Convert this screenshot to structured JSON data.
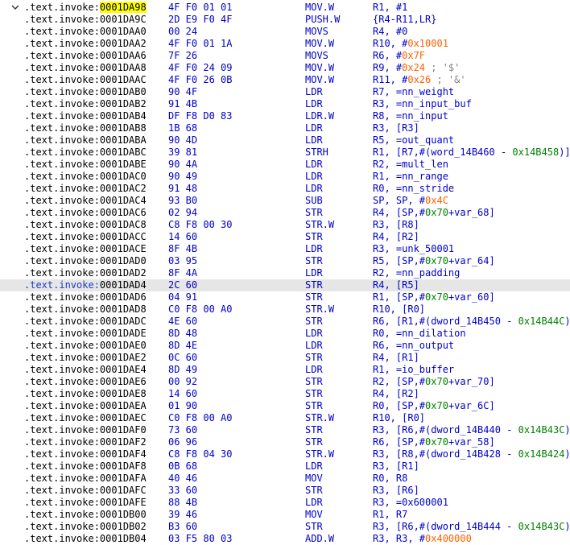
{
  "listing": {
    "rows": [
      {
        "seg": ".text.invoke:",
        "addr": "0001DA98",
        "bytes": "4F F0 01 01",
        "mn": "MOV.W",
        "ops": [
          [
            "R1, ",
            ""
          ],
          [
            "#1",
            ""
          ]
        ],
        "addr_highlight": true,
        "expanded": true
      },
      {
        "seg": ".text.invoke:",
        "addr": "0001DA9C",
        "bytes": "2D E9 F0 4F",
        "mn": "PUSH.W",
        "ops": [
          [
            "{R4-R11,LR}",
            ""
          ]
        ]
      },
      {
        "seg": ".text.invoke:",
        "addr": "0001DAA0",
        "bytes": "00 24",
        "mn": "MOVS",
        "ops": [
          [
            "R4, #0",
            ""
          ]
        ]
      },
      {
        "seg": ".text.invoke:",
        "addr": "0001DAA2",
        "bytes": "4F F0 01 1A",
        "mn": "MOV.W",
        "ops": [
          [
            "R10, #",
            ""
          ],
          [
            "0x10001",
            "num"
          ]
        ]
      },
      {
        "seg": ".text.invoke:",
        "addr": "0001DAA6",
        "bytes": "7F 26",
        "mn": "MOVS",
        "ops": [
          [
            "R6, #",
            ""
          ],
          [
            "0x7F",
            "num"
          ]
        ]
      },
      {
        "seg": ".text.invoke:",
        "addr": "0001DAA8",
        "bytes": "4F F0 24 09",
        "mn": "MOV.W",
        "ops": [
          [
            "R9, #",
            ""
          ],
          [
            "0x24",
            "num"
          ],
          [
            " ; '$'",
            "cmt"
          ]
        ]
      },
      {
        "seg": ".text.invoke:",
        "addr": "0001DAAC",
        "bytes": "4F F0 26 0B",
        "mn": "MOV.W",
        "ops": [
          [
            "R11, #",
            ""
          ],
          [
            "0x26",
            "num"
          ],
          [
            " ; '&'",
            "cmt"
          ]
        ]
      },
      {
        "seg": ".text.invoke:",
        "addr": "0001DAB0",
        "bytes": "90 4F",
        "mn": "LDR",
        "ops": [
          [
            "R7, =nn_weight",
            ""
          ]
        ]
      },
      {
        "seg": ".text.invoke:",
        "addr": "0001DAB2",
        "bytes": "91 4B",
        "mn": "LDR",
        "ops": [
          [
            "R3, =nn_input_buf",
            ""
          ]
        ]
      },
      {
        "seg": ".text.invoke:",
        "addr": "0001DAB4",
        "bytes": "DF F8 D0 83",
        "mn": "LDR.W",
        "ops": [
          [
            "R8, =nn_input",
            ""
          ]
        ]
      },
      {
        "seg": ".text.invoke:",
        "addr": "0001DAB8",
        "bytes": "1B 68",
        "mn": "LDR",
        "ops": [
          [
            "R3, [R3]",
            ""
          ]
        ]
      },
      {
        "seg": ".text.invoke:",
        "addr": "0001DABA",
        "bytes": "90 4D",
        "mn": "LDR",
        "ops": [
          [
            "R5, =out_quant",
            ""
          ]
        ]
      },
      {
        "seg": ".text.invoke:",
        "addr": "0001DABC",
        "bytes": "39 81",
        "mn": "STRH",
        "ops": [
          [
            "R1, [R7,#(word_14B460 - ",
            ""
          ],
          [
            "0x14B458",
            "grn"
          ],
          [
            ")]",
            ""
          ]
        ]
      },
      {
        "seg": ".text.invoke:",
        "addr": "0001DABE",
        "bytes": "90 4A",
        "mn": "LDR",
        "ops": [
          [
            "R2, =mult_len",
            ""
          ]
        ]
      },
      {
        "seg": ".text.invoke:",
        "addr": "0001DAC0",
        "bytes": "90 49",
        "mn": "LDR",
        "ops": [
          [
            "R1, =nn_range",
            ""
          ]
        ]
      },
      {
        "seg": ".text.invoke:",
        "addr": "0001DAC2",
        "bytes": "91 48",
        "mn": "LDR",
        "ops": [
          [
            "R0, =nn_stride",
            ""
          ]
        ]
      },
      {
        "seg": ".text.invoke:",
        "addr": "0001DAC4",
        "bytes": "93 B0",
        "mn": "SUB",
        "ops": [
          [
            "SP, SP, #",
            ""
          ],
          [
            "0x4C",
            "num"
          ]
        ]
      },
      {
        "seg": ".text.invoke:",
        "addr": "0001DAC6",
        "bytes": "02 94",
        "mn": "STR",
        "ops": [
          [
            "R4, [SP,#",
            ""
          ],
          [
            "0x70",
            "grn"
          ],
          [
            "+var_68]",
            ""
          ]
        ]
      },
      {
        "seg": ".text.invoke:",
        "addr": "0001DAC8",
        "bytes": "C8 F8 00 30",
        "mn": "STR.W",
        "ops": [
          [
            "R3, [R8]",
            ""
          ]
        ]
      },
      {
        "seg": ".text.invoke:",
        "addr": "0001DACC",
        "bytes": "14 60",
        "mn": "STR",
        "ops": [
          [
            "R4, [R2]",
            ""
          ]
        ]
      },
      {
        "seg": ".text.invoke:",
        "addr": "0001DACE",
        "bytes": "8F 4B",
        "mn": "LDR",
        "ops": [
          [
            "R3, =unk_50001",
            ""
          ]
        ]
      },
      {
        "seg": ".text.invoke:",
        "addr": "0001DAD0",
        "bytes": "03 95",
        "mn": "STR",
        "ops": [
          [
            "R5, [SP,#",
            ""
          ],
          [
            "0x70",
            "grn"
          ],
          [
            "+var_64]",
            ""
          ]
        ]
      },
      {
        "seg": ".text.invoke:",
        "addr": "0001DAD2",
        "bytes": "8F 4A",
        "mn": "LDR",
        "ops": [
          [
            "R2, =nn_padding",
            ""
          ]
        ]
      },
      {
        "seg": ".text.invoke:",
        "addr": "0001DAD4",
        "bytes": "2C 60",
        "mn": "STR",
        "ops": [
          [
            "R4, [R5]",
            ""
          ]
        ],
        "current": true
      },
      {
        "seg": ".text.invoke:",
        "addr": "0001DAD6",
        "bytes": "04 91",
        "mn": "STR",
        "ops": [
          [
            "R1, [SP,#",
            ""
          ],
          [
            "0x70",
            "grn"
          ],
          [
            "+var_60]",
            ""
          ]
        ]
      },
      {
        "seg": ".text.invoke:",
        "addr": "0001DAD8",
        "bytes": "C0 F8 00 A0",
        "mn": "STR.W",
        "ops": [
          [
            "R10, [R0]",
            ""
          ]
        ]
      },
      {
        "seg": ".text.invoke:",
        "addr": "0001DADC",
        "bytes": "4E 60",
        "mn": "STR",
        "ops": [
          [
            "R6, [R1,#(dword_14B450 - ",
            ""
          ],
          [
            "0x14B44C",
            "grn"
          ],
          [
            ")]",
            ""
          ]
        ]
      },
      {
        "seg": ".text.invoke:",
        "addr": "0001DADE",
        "bytes": "8D 48",
        "mn": "LDR",
        "ops": [
          [
            "R0, =nn_dilation",
            ""
          ]
        ]
      },
      {
        "seg": ".text.invoke:",
        "addr": "0001DAE0",
        "bytes": "8D 4E",
        "mn": "LDR",
        "ops": [
          [
            "R6, =nn_output",
            ""
          ]
        ]
      },
      {
        "seg": ".text.invoke:",
        "addr": "0001DAE2",
        "bytes": "0C 60",
        "mn": "STR",
        "ops": [
          [
            "R4, [R1]",
            ""
          ]
        ]
      },
      {
        "seg": ".text.invoke:",
        "addr": "0001DAE4",
        "bytes": "8D 49",
        "mn": "LDR",
        "ops": [
          [
            "R1, =io_buffer",
            ""
          ]
        ]
      },
      {
        "seg": ".text.invoke:",
        "addr": "0001DAE6",
        "bytes": "00 92",
        "mn": "STR",
        "ops": [
          [
            "R2, [SP,#",
            ""
          ],
          [
            "0x70",
            "grn"
          ],
          [
            "+var_70]",
            ""
          ]
        ]
      },
      {
        "seg": ".text.invoke:",
        "addr": "0001DAE8",
        "bytes": "14 60",
        "mn": "STR",
        "ops": [
          [
            "R4, [R2]",
            ""
          ]
        ]
      },
      {
        "seg": ".text.invoke:",
        "addr": "0001DAEA",
        "bytes": "01 90",
        "mn": "STR",
        "ops": [
          [
            "R0, [SP,#",
            ""
          ],
          [
            "0x70",
            "grn"
          ],
          [
            "+var_6C]",
            ""
          ]
        ]
      },
      {
        "seg": ".text.invoke:",
        "addr": "0001DAEC",
        "bytes": "C0 F8 00 A0",
        "mn": "STR.W",
        "ops": [
          [
            "R10, [R0]",
            ""
          ]
        ]
      },
      {
        "seg": ".text.invoke:",
        "addr": "0001DAF0",
        "bytes": "73 60",
        "mn": "STR",
        "ops": [
          [
            "R3, [R6,#(dword_14B440 - ",
            ""
          ],
          [
            "0x14B43C",
            "grn"
          ],
          [
            ")]",
            ""
          ]
        ]
      },
      {
        "seg": ".text.invoke:",
        "addr": "0001DAF2",
        "bytes": "06 96",
        "mn": "STR",
        "ops": [
          [
            "R6, [SP,#",
            ""
          ],
          [
            "0x70",
            "grn"
          ],
          [
            "+var_58]",
            ""
          ]
        ]
      },
      {
        "seg": ".text.invoke:",
        "addr": "0001DAF4",
        "bytes": "C8 F8 04 30",
        "mn": "STR.W",
        "ops": [
          [
            "R3, [R8,#(dword_14B428 - ",
            ""
          ],
          [
            "0x14B424",
            "grn"
          ],
          [
            ")]",
            ""
          ]
        ]
      },
      {
        "seg": ".text.invoke:",
        "addr": "0001DAF8",
        "bytes": "0B 68",
        "mn": "LDR",
        "ops": [
          [
            "R3, [R1]",
            ""
          ]
        ]
      },
      {
        "seg": ".text.invoke:",
        "addr": "0001DAFA",
        "bytes": "40 46",
        "mn": "MOV",
        "ops": [
          [
            "R0, R8",
            ""
          ]
        ]
      },
      {
        "seg": ".text.invoke:",
        "addr": "0001DAFC",
        "bytes": "33 60",
        "mn": "STR",
        "ops": [
          [
            "R3, [R6]",
            ""
          ]
        ]
      },
      {
        "seg": ".text.invoke:",
        "addr": "0001DAFE",
        "bytes": "88 4B",
        "mn": "LDR",
        "ops": [
          [
            "R3, =0x600001",
            ""
          ]
        ]
      },
      {
        "seg": ".text.invoke:",
        "addr": "0001DB00",
        "bytes": "39 46",
        "mn": "MOV",
        "ops": [
          [
            "R1, R7",
            ""
          ]
        ]
      },
      {
        "seg": ".text.invoke:",
        "addr": "0001DB02",
        "bytes": "B3 60",
        "mn": "STR",
        "ops": [
          [
            "R3, [R6,#(dword_14B444 - ",
            ""
          ],
          [
            "0x14B43C",
            "grn"
          ],
          [
            ")]",
            ""
          ]
        ]
      },
      {
        "seg": ".text.invoke:",
        "addr": "0001DB04",
        "bytes": "03 F5 80 03",
        "mn": "ADD.W",
        "ops": [
          [
            "R3, R3, #",
            ""
          ],
          [
            "0x400000",
            "num"
          ]
        ]
      }
    ]
  },
  "colors": {
    "mnemonic": "#0000c8",
    "number": "#ff6000",
    "offset": "#008000",
    "highlight": "#ffff00",
    "current_line": "#e6e6e6"
  },
  "icons": {
    "expand": "chevron-down-icon"
  }
}
